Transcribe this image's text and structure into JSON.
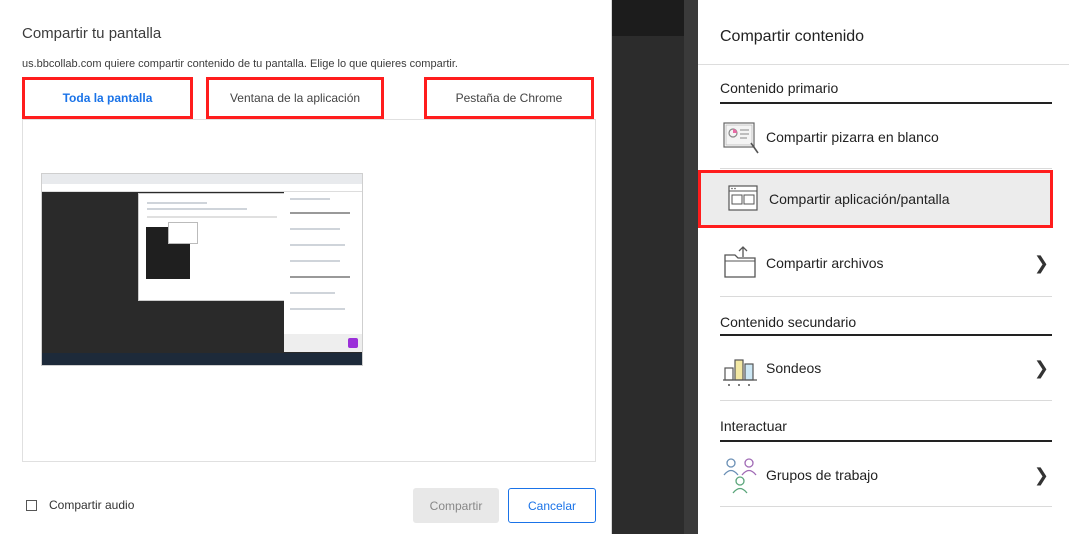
{
  "dialog": {
    "title": "Compartir tu pantalla",
    "subtitle": "us.bbcollab.com quiere compartir contenido de tu pantalla. Elige lo que quieres compartir.",
    "tabs": [
      {
        "label": "Toda la pantalla",
        "active": true
      },
      {
        "label": "Ventana de la aplicación",
        "active": false
      },
      {
        "label": "Pestaña de Chrome",
        "active": false
      }
    ],
    "audio_label": "Compartir audio",
    "share_label": "Compartir",
    "cancel_label": "Cancelar"
  },
  "panel": {
    "title": "Compartir contenido",
    "sections": [
      {
        "title": "Contenido primario"
      },
      {
        "title": "Contenido secundario"
      },
      {
        "title": "Interactuar"
      }
    ],
    "items": [
      {
        "label": "Compartir pizarra en blanco",
        "icon": "whiteboard-icon",
        "has_chevron": false
      },
      {
        "label": "Compartir aplicación/pantalla",
        "icon": "window-icon",
        "has_chevron": false,
        "highlighted": true
      },
      {
        "label": "Compartir archivos",
        "icon": "folder-icon",
        "has_chevron": true
      },
      {
        "label": "Sondeos",
        "icon": "poll-icon",
        "has_chevron": true
      },
      {
        "label": "Grupos de trabajo",
        "icon": "groups-icon",
        "has_chevron": true
      }
    ]
  },
  "colors": {
    "accent": "#1a73e8",
    "highlight_border": "#ff1d1d"
  }
}
